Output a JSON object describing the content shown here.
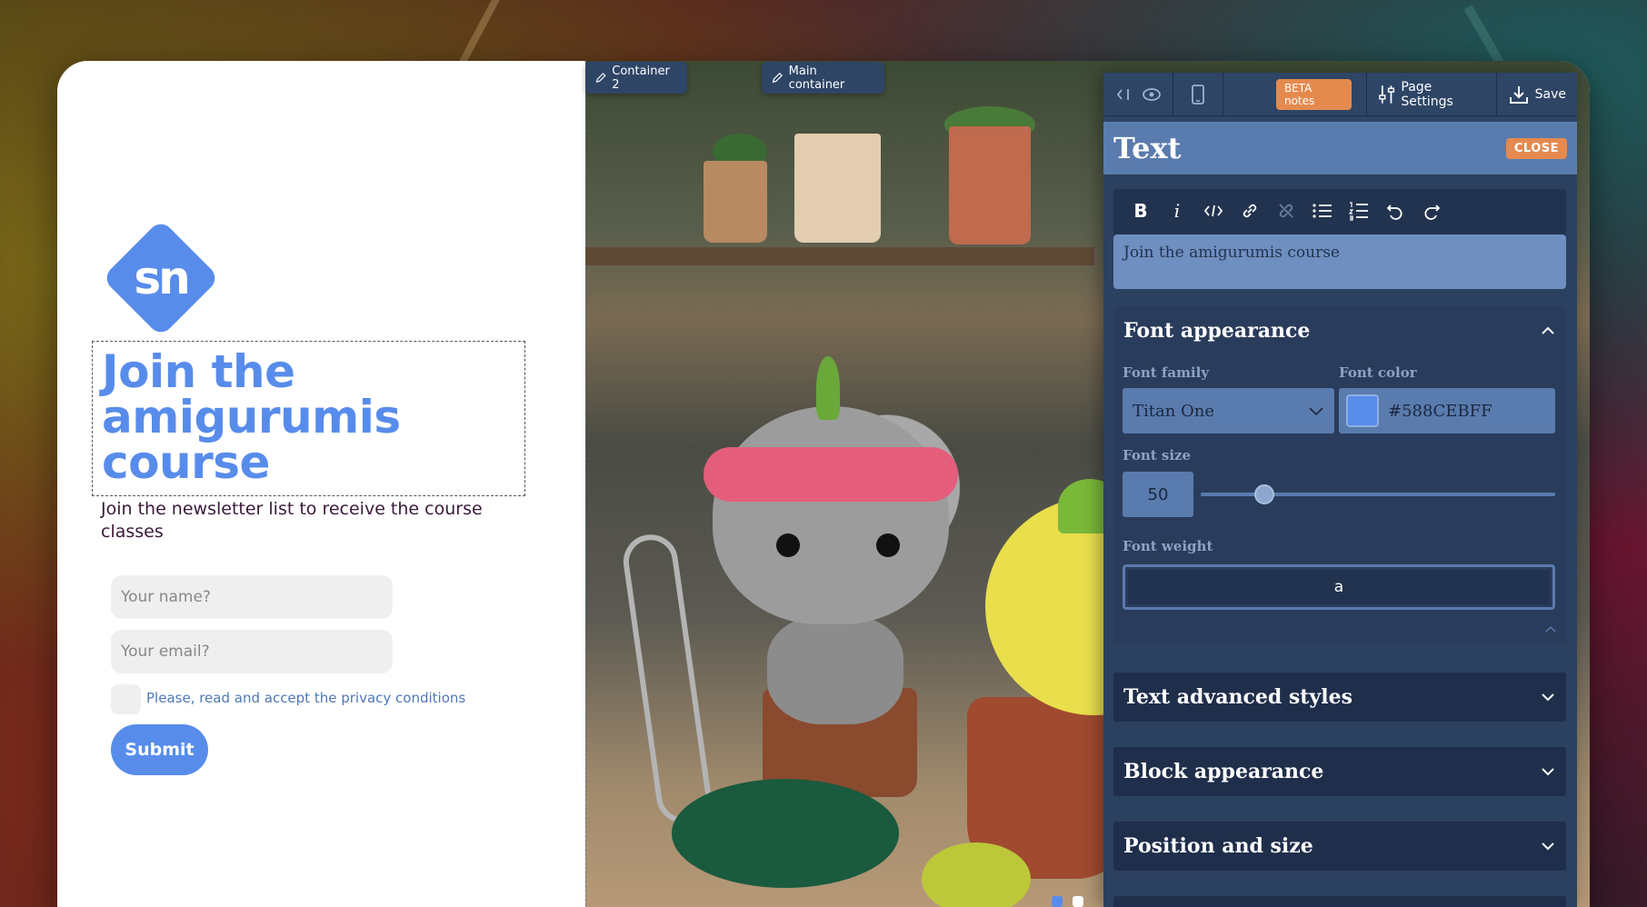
{
  "left": {
    "logo_text": "sn",
    "heading": "Join the amigurumis course",
    "subtext": "Join the newsletter list to receive the course classes",
    "name_placeholder": "Your name?",
    "email_placeholder": "Your email?",
    "privacy": "Please, read and accept the privacy conditions",
    "submit": "Submit"
  },
  "tags": {
    "container2": "Container 2",
    "main_container": "Main container"
  },
  "topbar": {
    "beta": "BETA notes",
    "page_settings": "Page Settings",
    "save": "Save"
  },
  "panel": {
    "title": "Text",
    "close": "CLOSE",
    "editor_text": "Join the amigurumis course",
    "font_section": "Font appearance",
    "font_family_label": "Font family",
    "font_family_value": "Titan One",
    "font_color_label": "Font color",
    "font_color_value": "#588CEBFF",
    "font_size_label": "Font size",
    "font_size_value": "50",
    "font_size_slider_fraction": 0.18,
    "font_weight_label": "Font weight",
    "font_weight_value": "a",
    "adv_section": "Text advanced styles",
    "block_section": "Block appearance",
    "position_section": "Position and size"
  },
  "colors": {
    "brand": "#588CEB",
    "accent": "#E58A4E",
    "panel": "#2F4468"
  },
  "icons": [
    "sidebar-toggle-icon",
    "eye-icon",
    "mobile-icon",
    "sliders-icon",
    "download-icon",
    "bold-icon",
    "italic-icon",
    "code-icon",
    "link-icon",
    "unlink-icon",
    "bullet-list-icon",
    "numbered-list-icon",
    "undo-icon",
    "redo-icon",
    "chevron-up-icon",
    "chevron-down-icon",
    "pencil-icon"
  ]
}
